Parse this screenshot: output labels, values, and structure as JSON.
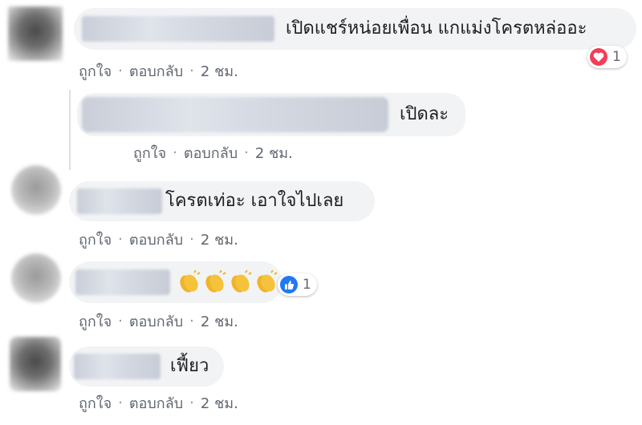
{
  "comments": [
    {
      "text": "เปิดแชร์หน่อยเพื่อน แกแม่งโครตหล่ออะ",
      "reaction_count": "1"
    },
    {
      "text": "เปิดละ"
    },
    {
      "text": "โครตเท่อะ เอาใจไปเลย"
    },
    {
      "emoji": "👏👏👏👏",
      "reaction_count": "1"
    },
    {
      "text": "เฟี้ยว"
    }
  ],
  "actions": {
    "like": "ถูกใจ",
    "reply": "ตอบกลับ",
    "time": "2 ชม.",
    "separator": "·"
  },
  "colors": {
    "bubble": "#f2f3f5",
    "action_text": "#606770",
    "love": "#f33e58",
    "like": "#2078f4",
    "clap": "#f5c33b"
  },
  "icons": {
    "love": "heart-icon",
    "like": "thumbs-up-icon",
    "clap": "clapping-hands-icon"
  }
}
